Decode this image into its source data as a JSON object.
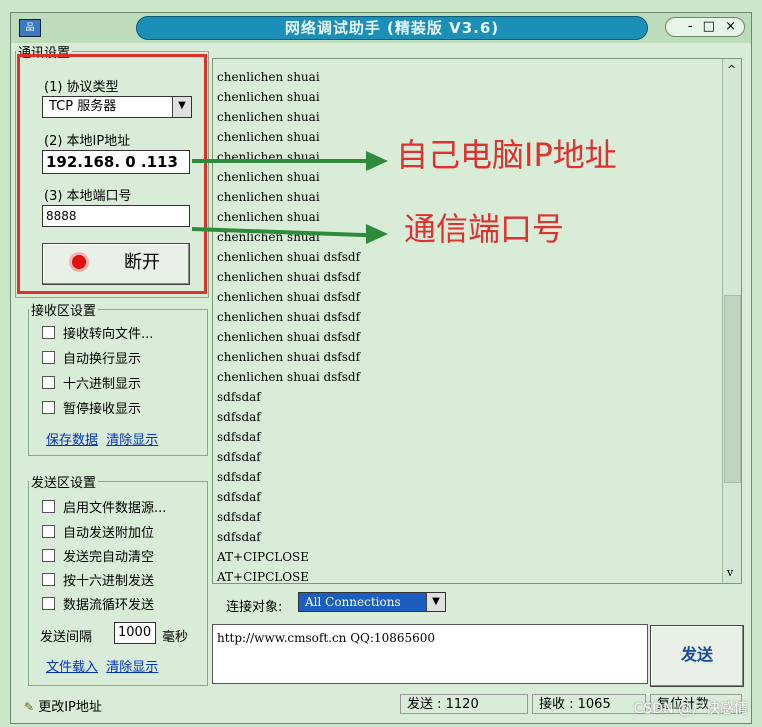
{
  "window": {
    "title": "网络调试助手 (精装版 V3.6)",
    "icon_text": "品",
    "min_label": "-",
    "max_label": "□",
    "close_label": "×"
  },
  "comm": {
    "legend": "通讯设置",
    "protocol_label": "(1) 协议类型",
    "protocol_value": "TCP 服务器",
    "ip_label": "(2) 本地IP地址",
    "ip_value": "192.168. 0 .113",
    "port_label": "(3) 本地端口号",
    "port_value": "8888",
    "disconnect_label": "断开"
  },
  "recv": {
    "legend": "接收区设置",
    "options": [
      "接收转向文件...",
      "自动换行显示",
      "十六进制显示",
      "暂停接收显示"
    ],
    "save_link": "保存数据",
    "clear_link": "清除显示"
  },
  "send": {
    "legend": "发送区设置",
    "options": [
      "启用文件数据源...",
      "自动发送附加位",
      "发送完自动清空",
      "按十六进制发送",
      "数据流循环发送"
    ],
    "interval_label": "发送间隔",
    "interval_value": "1000",
    "interval_unit": "毫秒",
    "load_link": "文件载入",
    "clear_link": "清除显示"
  },
  "log": {
    "lines": [
      "chenlichen shuai",
      "chenlichen shuai",
      "chenlichen shuai",
      "chenlichen shuai",
      "chenlichen shuai",
      "chenlichen shuai",
      "chenlichen shuai",
      "chenlichen shuai",
      "chenlichen shuai",
      "chenlichen shuai dsfsdf",
      "chenlichen shuai dsfsdf",
      "chenlichen shuai dsfsdf",
      "chenlichen shuai dsfsdf",
      "chenlichen shuai dsfsdf",
      "chenlichen shuai dsfsdf",
      "chenlichen shuai dsfsdf",
      "sdfsdaf",
      "sdfsdaf",
      "sdfsdaf",
      "sdfsdaf",
      "sdfsdaf",
      "sdfsdaf",
      "sdfsdaf",
      "sdfsdaf",
      "AT+CIPCLOSE",
      "AT+CIPCLOSE"
    ]
  },
  "target": {
    "label": "连接对象:",
    "value": "All Connections"
  },
  "send_box": {
    "text": "http://www.cmsoft.cn QQ:10865600",
    "send_button": "发送"
  },
  "status": {
    "change_ip": "更改IP地址",
    "sent": "发送 : 1120",
    "received": "接收 : 1065",
    "reset": "复位计数"
  },
  "annotations": {
    "ip_note": "自己电脑IP地址",
    "port_note": "通信端口号"
  },
  "watermark": "CSDN @尸快感情",
  "colors": {
    "annotation": "#e03030",
    "arrow": "#2e8b3a",
    "title_bar": "#1a8fb8"
  }
}
